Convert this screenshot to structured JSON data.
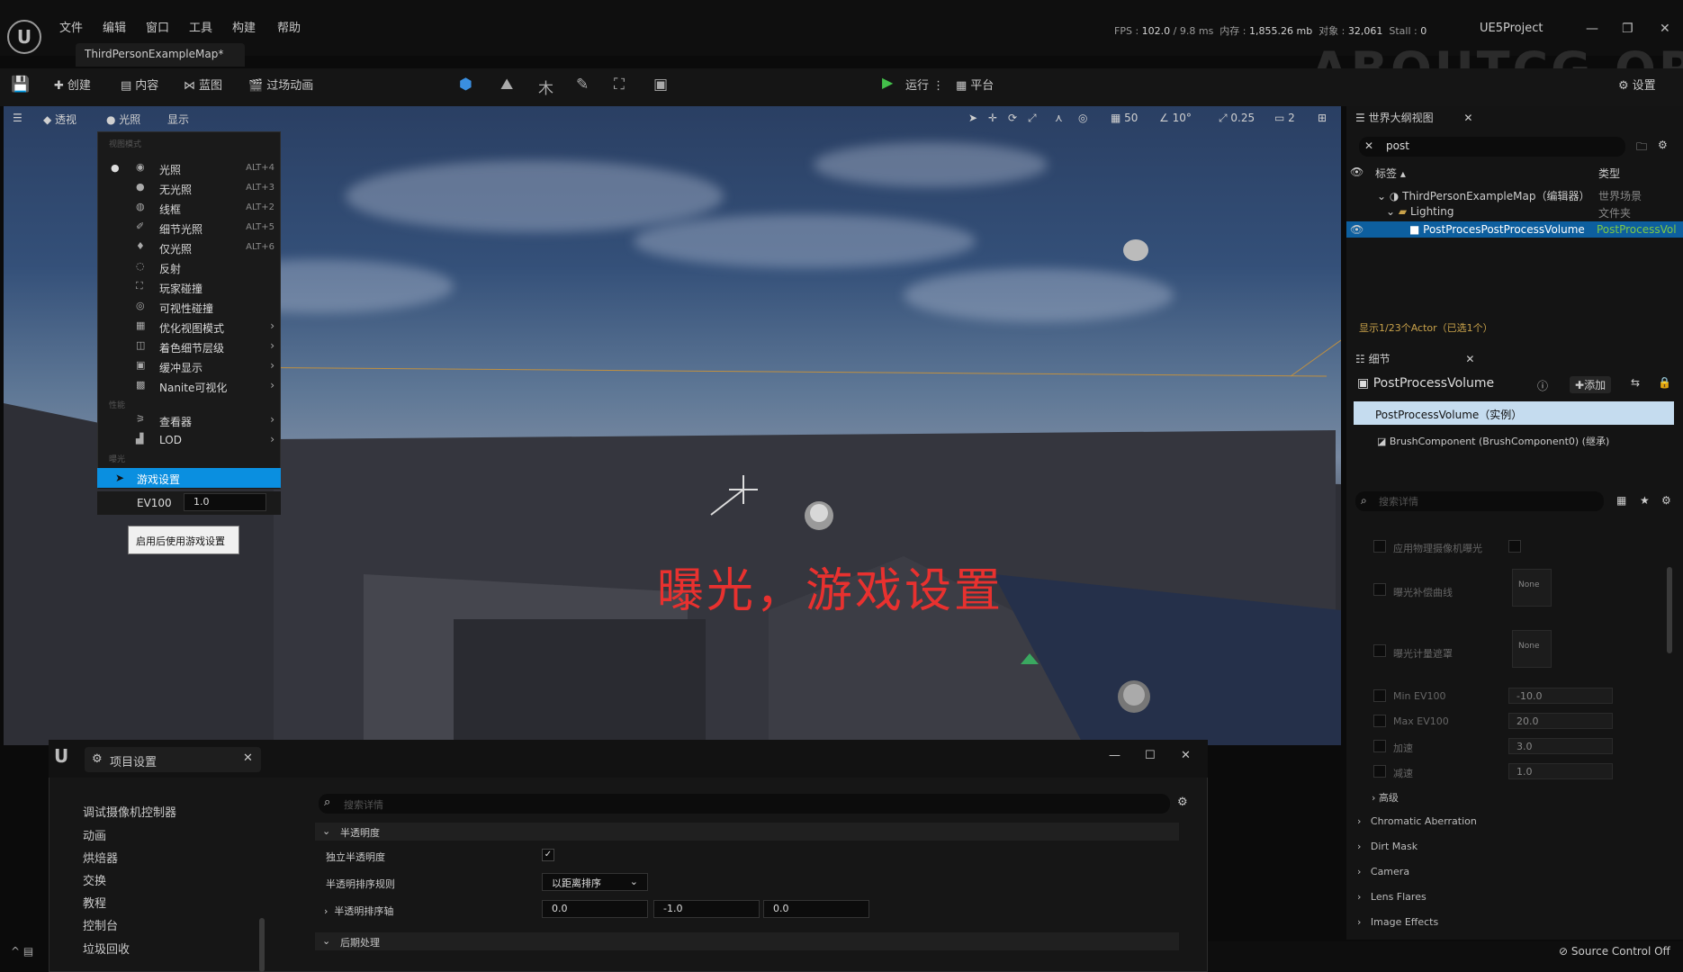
{
  "menu": [
    "文件",
    "编辑",
    "窗口",
    "工具",
    "构建",
    "帮助"
  ],
  "map_tab": "ThirdPersonExampleMap*",
  "stats": {
    "fps_label": "FPS :",
    "fps": "102.0",
    "ms": "/ 9.8 ms",
    "mem_label": "内存 :",
    "mem": "1,855.26 mb",
    "obj_label": "对象 :",
    "obj": "32,061",
    "stall_label": "Stall :",
    "stall": "0"
  },
  "project_name": "UE5Project",
  "watermark": "ABOUTCG.ORG",
  "toolbar": {
    "create": "创建",
    "content": "内容",
    "blueprint": "蓝图",
    "cinematics": "过场动画",
    "run": "运行",
    "platform": "平台",
    "settings": "设置"
  },
  "viewport": {
    "perspective": "透视",
    "lit": "光照",
    "show": "显示",
    "grid": "50",
    "angle": "10°",
    "scale": "0.25",
    "cameras": "2",
    "caption": "曝光，游戏设置"
  },
  "view_menu": {
    "header1": "视图模式",
    "items": [
      {
        "label": "光照",
        "shortcut": "ALT+4",
        "selected": true
      },
      {
        "label": "无光照",
        "shortcut": "ALT+3"
      },
      {
        "label": "线框",
        "shortcut": "ALT+2"
      },
      {
        "label": "细节光照",
        "shortcut": "ALT+5"
      },
      {
        "label": "仅光照",
        "shortcut": "ALT+6"
      },
      {
        "label": "反射",
        "shortcut": ""
      },
      {
        "label": "玩家碰撞",
        "shortcut": ""
      },
      {
        "label": "可视性碰撞",
        "shortcut": ""
      },
      {
        "label": "优化视图模式",
        "submenu": true
      },
      {
        "label": "着色细节层级",
        "submenu": true
      },
      {
        "label": "缓冲显示",
        "submenu": true
      },
      {
        "label": "Nanite可视化",
        "submenu": true
      }
    ],
    "header2": "性能",
    "items2": [
      {
        "label": "查看器",
        "submenu": true
      },
      {
        "label": "LOD",
        "submenu": true
      }
    ],
    "header3": "曝光",
    "game_settings": "游戏设置",
    "ev_label": "EV100",
    "ev_value": "1.0",
    "tooltip": "启用后使用游戏设置"
  },
  "outliner": {
    "title": "世界大纲视图",
    "search": "post",
    "col_label": "标签",
    "col_type": "类型",
    "rows": [
      {
        "label": "ThirdPersonExampleMap（编辑器）",
        "type": "世界场景"
      },
      {
        "label": "Lighting",
        "type": "文件夹"
      },
      {
        "label": "PostProcesPostProcessVolume",
        "type": "PostProcessVol"
      }
    ],
    "footer": "显示1/23个Actor（已选1个）"
  },
  "details": {
    "title": "细节",
    "object": "PostProcessVolume",
    "add": "添加",
    "instance": "PostProcessVolume（实例）",
    "component": "BrushComponent (BrushComponent0) (继承)",
    "search_placeholder": "搜索详情",
    "rows": [
      {
        "label": "应用物理摄像机曝光",
        "value": ""
      },
      {
        "label": "曝光补偿曲线",
        "value": "None"
      },
      {
        "label": "曝光计量遮罩",
        "value": "None"
      },
      {
        "label": "Min EV100",
        "value": "-10.0"
      },
      {
        "label": "Max EV100",
        "value": "20.0"
      },
      {
        "label": "加速",
        "value": "3.0"
      },
      {
        "label": "减速",
        "value": "1.0"
      }
    ],
    "advanced": "高级",
    "sections": [
      "Chromatic Aberration",
      "Dirt Mask",
      "Camera",
      "Lens Flares",
      "Image Effects"
    ]
  },
  "project_settings": {
    "title": "项目设置",
    "left_items": [
      "调试摄像机控制器",
      "动画",
      "烘焙器",
      "交换",
      "教程",
      "控制台",
      "垃圾回收"
    ],
    "search_placeholder": "搜索详情",
    "section1": "半透明度",
    "row1": "独立半透明度",
    "row2": "半透明排序规则",
    "row2_value": "以距离排序",
    "row3": "半透明排序轴",
    "axis": [
      "0.0",
      "-1.0",
      "0.0"
    ],
    "section2": "后期处理"
  },
  "status": {
    "source_control": "Source Control Off"
  },
  "colors": {
    "accent": "#0a8fe0",
    "caption": "#e8312f",
    "play": "#43c04a",
    "selection": "#0d5f9f"
  }
}
